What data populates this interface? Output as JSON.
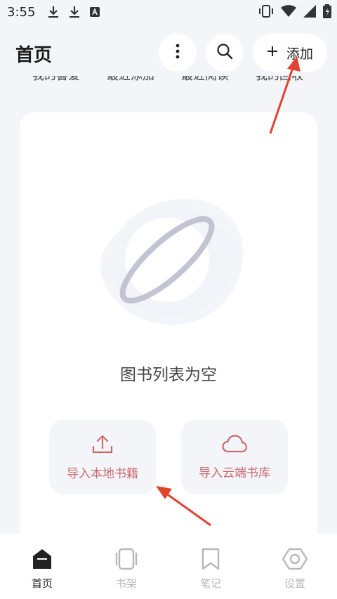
{
  "status_bar": {
    "time": "3:55",
    "left_icons": [
      "download-icon",
      "download-icon",
      "font-icon"
    ],
    "right_icons": [
      "vibrate-icon",
      "wifi-icon",
      "signal-icon",
      "battery-icon"
    ]
  },
  "header": {
    "title": "首页",
    "more_icon": "more-vertical-icon",
    "search_icon": "search-icon",
    "add_label": "添加"
  },
  "tabs": [
    "我的喜爱",
    "最近添加",
    "最近阅读",
    "我的回收"
  ],
  "main": {
    "empty_text": "图书列表为空",
    "import_local_label": "导入本地书籍",
    "import_cloud_label": "导入云端书库"
  },
  "bottom_nav": [
    {
      "label": "首页",
      "icon": "home-icon",
      "active": true
    },
    {
      "label": "书架",
      "icon": "bookshelf-icon",
      "active": false
    },
    {
      "label": "笔记",
      "icon": "bookmark-icon",
      "active": false
    },
    {
      "label": "设置",
      "icon": "settings-icon",
      "active": false
    }
  ],
  "colors": {
    "background": "#f4f5f8",
    "accent": "#c86b72",
    "annotation_arrow": "#e0432f",
    "inactive": "#b8b8bc"
  }
}
